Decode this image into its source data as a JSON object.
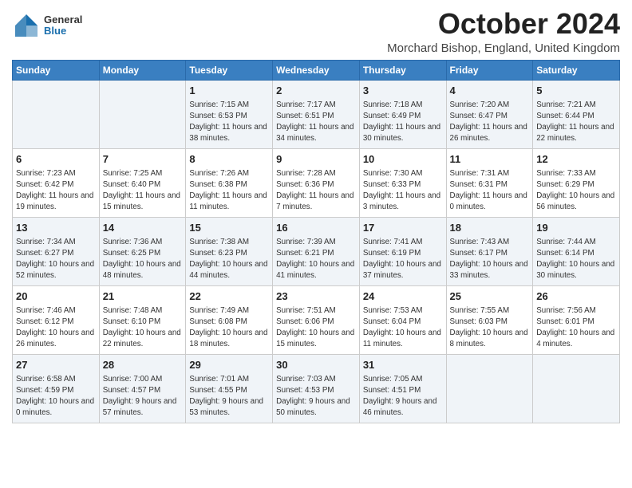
{
  "header": {
    "logo_general": "General",
    "logo_blue": "Blue",
    "month_title": "October 2024",
    "location": "Morchard Bishop, England, United Kingdom"
  },
  "weekdays": [
    "Sunday",
    "Monday",
    "Tuesday",
    "Wednesday",
    "Thursday",
    "Friday",
    "Saturday"
  ],
  "weeks": [
    [
      {
        "day": "",
        "info": ""
      },
      {
        "day": "",
        "info": ""
      },
      {
        "day": "1",
        "info": "Sunrise: 7:15 AM\nSunset: 6:53 PM\nDaylight: 11 hours and 38 minutes."
      },
      {
        "day": "2",
        "info": "Sunrise: 7:17 AM\nSunset: 6:51 PM\nDaylight: 11 hours and 34 minutes."
      },
      {
        "day": "3",
        "info": "Sunrise: 7:18 AM\nSunset: 6:49 PM\nDaylight: 11 hours and 30 minutes."
      },
      {
        "day": "4",
        "info": "Sunrise: 7:20 AM\nSunset: 6:47 PM\nDaylight: 11 hours and 26 minutes."
      },
      {
        "day": "5",
        "info": "Sunrise: 7:21 AM\nSunset: 6:44 PM\nDaylight: 11 hours and 22 minutes."
      }
    ],
    [
      {
        "day": "6",
        "info": "Sunrise: 7:23 AM\nSunset: 6:42 PM\nDaylight: 11 hours and 19 minutes."
      },
      {
        "day": "7",
        "info": "Sunrise: 7:25 AM\nSunset: 6:40 PM\nDaylight: 11 hours and 15 minutes."
      },
      {
        "day": "8",
        "info": "Sunrise: 7:26 AM\nSunset: 6:38 PM\nDaylight: 11 hours and 11 minutes."
      },
      {
        "day": "9",
        "info": "Sunrise: 7:28 AM\nSunset: 6:36 PM\nDaylight: 11 hours and 7 minutes."
      },
      {
        "day": "10",
        "info": "Sunrise: 7:30 AM\nSunset: 6:33 PM\nDaylight: 11 hours and 3 minutes."
      },
      {
        "day": "11",
        "info": "Sunrise: 7:31 AM\nSunset: 6:31 PM\nDaylight: 11 hours and 0 minutes."
      },
      {
        "day": "12",
        "info": "Sunrise: 7:33 AM\nSunset: 6:29 PM\nDaylight: 10 hours and 56 minutes."
      }
    ],
    [
      {
        "day": "13",
        "info": "Sunrise: 7:34 AM\nSunset: 6:27 PM\nDaylight: 10 hours and 52 minutes."
      },
      {
        "day": "14",
        "info": "Sunrise: 7:36 AM\nSunset: 6:25 PM\nDaylight: 10 hours and 48 minutes."
      },
      {
        "day": "15",
        "info": "Sunrise: 7:38 AM\nSunset: 6:23 PM\nDaylight: 10 hours and 44 minutes."
      },
      {
        "day": "16",
        "info": "Sunrise: 7:39 AM\nSunset: 6:21 PM\nDaylight: 10 hours and 41 minutes."
      },
      {
        "day": "17",
        "info": "Sunrise: 7:41 AM\nSunset: 6:19 PM\nDaylight: 10 hours and 37 minutes."
      },
      {
        "day": "18",
        "info": "Sunrise: 7:43 AM\nSunset: 6:17 PM\nDaylight: 10 hours and 33 minutes."
      },
      {
        "day": "19",
        "info": "Sunrise: 7:44 AM\nSunset: 6:14 PM\nDaylight: 10 hours and 30 minutes."
      }
    ],
    [
      {
        "day": "20",
        "info": "Sunrise: 7:46 AM\nSunset: 6:12 PM\nDaylight: 10 hours and 26 minutes."
      },
      {
        "day": "21",
        "info": "Sunrise: 7:48 AM\nSunset: 6:10 PM\nDaylight: 10 hours and 22 minutes."
      },
      {
        "day": "22",
        "info": "Sunrise: 7:49 AM\nSunset: 6:08 PM\nDaylight: 10 hours and 18 minutes."
      },
      {
        "day": "23",
        "info": "Sunrise: 7:51 AM\nSunset: 6:06 PM\nDaylight: 10 hours and 15 minutes."
      },
      {
        "day": "24",
        "info": "Sunrise: 7:53 AM\nSunset: 6:04 PM\nDaylight: 10 hours and 11 minutes."
      },
      {
        "day": "25",
        "info": "Sunrise: 7:55 AM\nSunset: 6:03 PM\nDaylight: 10 hours and 8 minutes."
      },
      {
        "day": "26",
        "info": "Sunrise: 7:56 AM\nSunset: 6:01 PM\nDaylight: 10 hours and 4 minutes."
      }
    ],
    [
      {
        "day": "27",
        "info": "Sunrise: 6:58 AM\nSunset: 4:59 PM\nDaylight: 10 hours and 0 minutes."
      },
      {
        "day": "28",
        "info": "Sunrise: 7:00 AM\nSunset: 4:57 PM\nDaylight: 9 hours and 57 minutes."
      },
      {
        "day": "29",
        "info": "Sunrise: 7:01 AM\nSunset: 4:55 PM\nDaylight: 9 hours and 53 minutes."
      },
      {
        "day": "30",
        "info": "Sunrise: 7:03 AM\nSunset: 4:53 PM\nDaylight: 9 hours and 50 minutes."
      },
      {
        "day": "31",
        "info": "Sunrise: 7:05 AM\nSunset: 4:51 PM\nDaylight: 9 hours and 46 minutes."
      },
      {
        "day": "",
        "info": ""
      },
      {
        "day": "",
        "info": ""
      }
    ]
  ]
}
